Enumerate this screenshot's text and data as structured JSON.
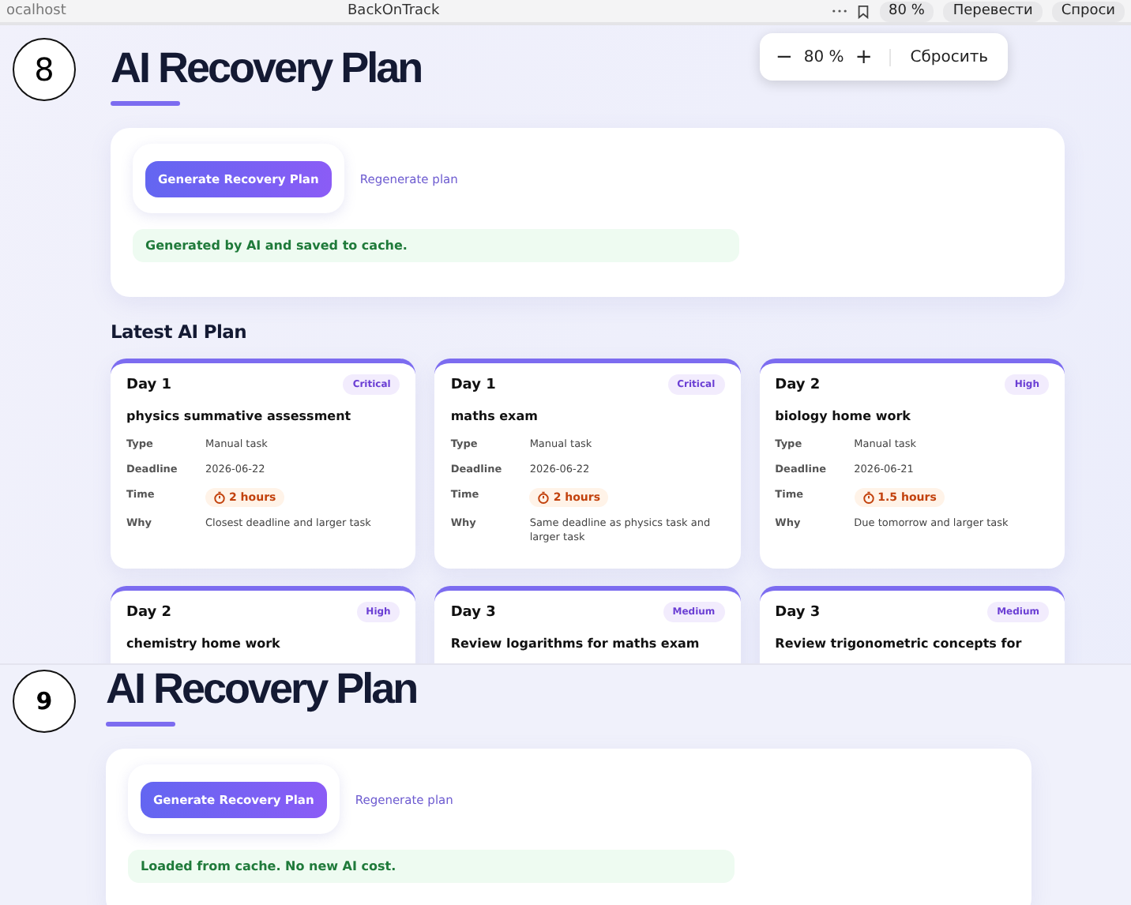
{
  "browser_bar": {
    "address": "ocalhost",
    "title": "BackOnTrack",
    "zoom": "80 %",
    "translate": "Перевести",
    "ask": "Спроси"
  },
  "zoom_popup": {
    "minus": "−",
    "value": "80 %",
    "plus": "+",
    "reset": "Сбросить"
  },
  "screens": [
    {
      "step": "8",
      "title": "AI Recovery Plan",
      "generate_button": "Generate Recovery Plan",
      "regenerate_link": "Regenerate plan",
      "status": "Generated by AI and saved to cache.",
      "section_title": "Latest AI Plan",
      "cards": [
        {
          "day": "Day 1",
          "priority": "Critical",
          "title": "physics summative assessment",
          "rows": [
            {
              "kind": "text",
              "label": "Type",
              "value": "Manual task"
            },
            {
              "kind": "text",
              "label": "Deadline",
              "value": "2026-06-22"
            },
            {
              "kind": "time",
              "label": "Time",
              "value": "2 hours"
            },
            {
              "kind": "text",
              "label": "Why",
              "value": "Closest deadline and larger task"
            }
          ]
        },
        {
          "day": "Day 1",
          "priority": "Critical",
          "title": "maths exam",
          "rows": [
            {
              "kind": "text",
              "label": "Type",
              "value": "Manual task"
            },
            {
              "kind": "text",
              "label": "Deadline",
              "value": "2026-06-22"
            },
            {
              "kind": "time",
              "label": "Time",
              "value": "2 hours"
            },
            {
              "kind": "text",
              "label": "Why",
              "value": "Same deadline as physics task and larger task"
            }
          ]
        },
        {
          "day": "Day 2",
          "priority": "High",
          "title": "biology home work",
          "rows": [
            {
              "kind": "text",
              "label": "Type",
              "value": "Manual task"
            },
            {
              "kind": "text",
              "label": "Deadline",
              "value": "2026-06-21"
            },
            {
              "kind": "time",
              "label": "Time",
              "value": "1.5 hours"
            },
            {
              "kind": "text",
              "label": "Why",
              "value": "Due tomorrow and larger task"
            }
          ]
        },
        {
          "day": "Day 2",
          "priority": "High",
          "title": "chemistry home work"
        },
        {
          "day": "Day 3",
          "priority": "Medium",
          "title": "Review logarithms for maths exam"
        },
        {
          "day": "Day 3",
          "priority": "Medium",
          "title": "Review trigonometric concepts for"
        }
      ]
    },
    {
      "step": "9",
      "title": "AI Recovery Plan",
      "generate_button": "Generate Recovery Plan",
      "regenerate_link": "Regenerate plan",
      "status": "Loaded from cache. No new AI cost."
    }
  ]
}
